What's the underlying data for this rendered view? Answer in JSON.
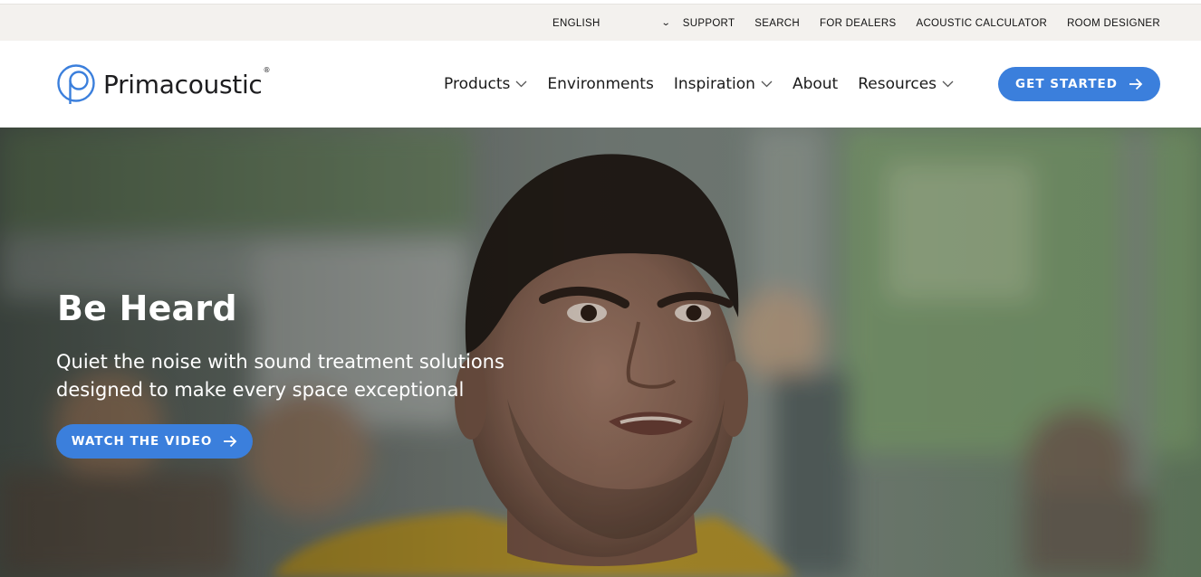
{
  "utility_bar": {
    "language": "ENGLISH",
    "links": [
      "SUPPORT",
      "SEARCH",
      "FOR DEALERS",
      "ACOUSTIC CALCULATOR",
      "ROOM DESIGNER"
    ]
  },
  "header": {
    "logo_text": "Primacoustic",
    "logo_mark": "®",
    "nav": [
      {
        "label": "Products",
        "has_dropdown": true
      },
      {
        "label": "Environments",
        "has_dropdown": false
      },
      {
        "label": "Inspiration",
        "has_dropdown": true
      },
      {
        "label": "About",
        "has_dropdown": false
      },
      {
        "label": "Resources",
        "has_dropdown": true
      }
    ],
    "cta_label": "GET STARTED"
  },
  "hero": {
    "title": "Be Heard",
    "subtitle_line1": "Quiet the noise with sound treatment solutions",
    "subtitle_line2": "designed to make every space exceptional",
    "cta_label": "WATCH THE VIDEO"
  },
  "colors": {
    "accent": "#3b7fdc",
    "utility_bg": "#f3f1ee"
  },
  "icons": {
    "logo": "p-circle-icon",
    "dropdown": "chevron-down-icon",
    "cta": "arrow-right-icon"
  }
}
